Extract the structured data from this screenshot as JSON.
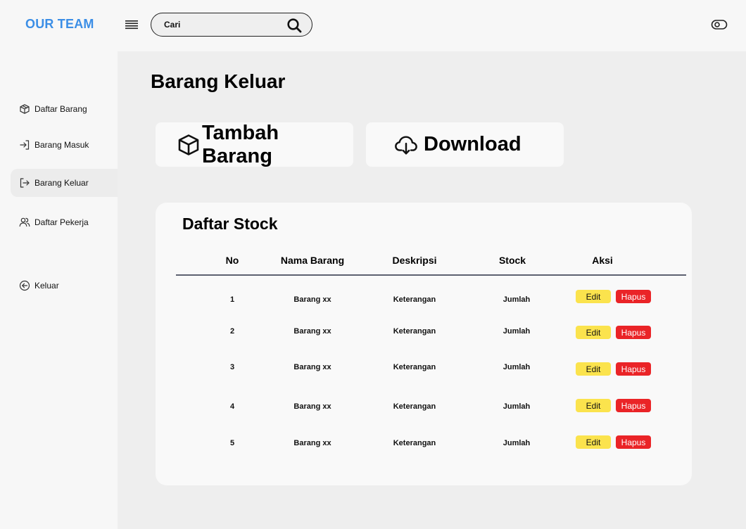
{
  "brand": {
    "name": "OUR TEAM",
    "color": "#3b8ee6"
  },
  "search": {
    "placeholder": "Cari",
    "icon": "search-icon"
  },
  "topbar": {
    "menu_icon": "hamburger-icon",
    "toggle_icon": "toggle-icon"
  },
  "sidebar": {
    "items": [
      {
        "label": "Daftar Barang",
        "icon": "box-icon",
        "active": false
      },
      {
        "label": "Barang Masuk",
        "icon": "login-arrow-icon",
        "active": false
      },
      {
        "label": "Barang Keluar",
        "icon": "logout-arrow-icon",
        "active": true
      },
      {
        "label": "Daftar Pekerja",
        "icon": "users-icon",
        "active": false
      },
      {
        "label": "Keluar",
        "icon": "circle-arrow-left-icon",
        "active": false
      }
    ]
  },
  "page": {
    "title": "Barang Keluar"
  },
  "actions": {
    "add_label": "Tambah Barang",
    "add_icon": "box-icon",
    "download_label": "Download",
    "download_icon": "cloud-download-icon"
  },
  "table": {
    "title": "Daftar Stock",
    "headers": [
      "No",
      "Nama Barang",
      "Deskripsi",
      "Stock",
      "Aksi"
    ],
    "edit_label": "Edit",
    "delete_label": "Hapus",
    "edit_color": "#fbe34d",
    "delete_color": "#ea2427",
    "rows": [
      {
        "no": "1",
        "name": "Barang xx",
        "desc": "Keterangan",
        "stock": "Jumlah"
      },
      {
        "no": "2",
        "name": "Barang xx",
        "desc": "Keterangan",
        "stock": "Jumlah"
      },
      {
        "no": "3",
        "name": "Barang xx",
        "desc": "Keterangan",
        "stock": "Jumlah"
      },
      {
        "no": "4",
        "name": "Barang xx",
        "desc": "Keterangan",
        "stock": "Jumlah"
      },
      {
        "no": "5",
        "name": "Barang xx",
        "desc": "Keterangan",
        "stock": "Jumlah"
      }
    ]
  }
}
